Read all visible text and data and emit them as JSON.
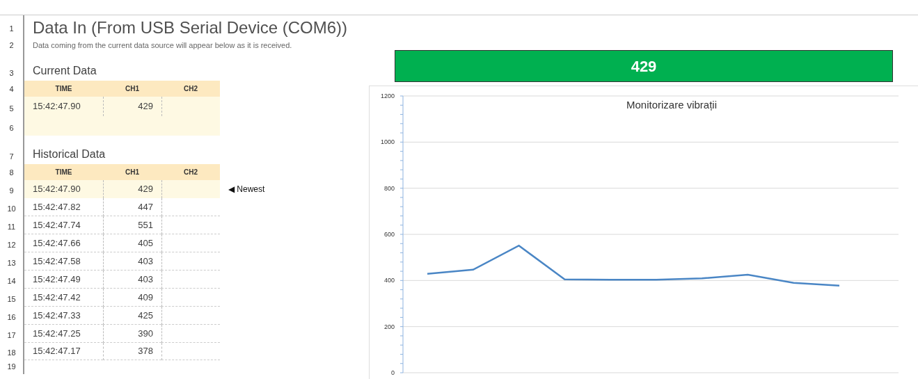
{
  "title": "Data In (From USB Serial Device (COM6))",
  "subtitle": "Data coming from the current data source will appear below as it is received.",
  "row_numbers": [
    "1",
    "2",
    "3",
    "4",
    "5",
    "6",
    "7",
    "8",
    "9",
    "10",
    "11",
    "12",
    "13",
    "14",
    "15",
    "16",
    "17",
    "18",
    "19"
  ],
  "current_data": {
    "heading": "Current Data",
    "columns": [
      "TIME",
      "CH1",
      "CH2"
    ],
    "rows": [
      {
        "time": "15:42:47.90",
        "ch1": "429"
      }
    ]
  },
  "historical_data": {
    "heading": "Historical Data",
    "columns": [
      "TIME",
      "CH1",
      "CH2"
    ],
    "newest_marker": "◀ Newest",
    "rows": [
      {
        "time": "15:42:47.90",
        "ch1": "429",
        "highlighted": true
      },
      {
        "time": "15:42:47.82",
        "ch1": "447",
        "highlighted": false
      },
      {
        "time": "15:42:47.74",
        "ch1": "551",
        "highlighted": false
      },
      {
        "time": "15:42:47.66",
        "ch1": "405",
        "highlighted": false
      },
      {
        "time": "15:42:47.58",
        "ch1": "403",
        "highlighted": false
      },
      {
        "time": "15:42:47.49",
        "ch1": "403",
        "highlighted": false
      },
      {
        "time": "15:42:47.42",
        "ch1": "409",
        "highlighted": false
      },
      {
        "time": "15:42:47.33",
        "ch1": "425",
        "highlighted": false
      },
      {
        "time": "15:42:47.25",
        "ch1": "390",
        "highlighted": false
      },
      {
        "time": "15:42:47.17",
        "ch1": "378",
        "highlighted": false
      }
    ]
  },
  "value_banner": {
    "value": "429"
  },
  "chart": {
    "chart_data": {
      "type": "line",
      "title": "Monitorizare vibrații",
      "ylim": [
        0,
        1200
      ],
      "yticks": [
        0,
        200,
        400,
        600,
        800,
        1000,
        1200
      ],
      "grid": true,
      "series": [
        {
          "color": "#4a86c5",
          "values": [
            429,
            447,
            551,
            405,
            403,
            403,
            409,
            425,
            390,
            378
          ]
        }
      ]
    }
  }
}
